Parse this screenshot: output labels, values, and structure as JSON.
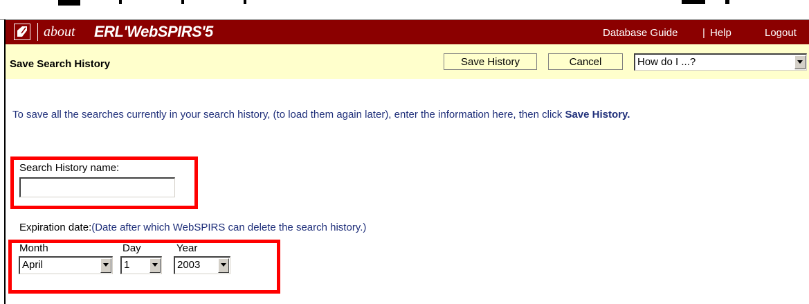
{
  "banner": {
    "brand_about": "about",
    "brand_product": "ERL'WebSPIRS'5",
    "database_guide_link": "Database Guide",
    "separator": "|",
    "help_link": "Help",
    "logout_link": "Logout",
    "background_color": "#8b0000"
  },
  "toolbar": {
    "page_title": "Save Search History",
    "save_history_label": "Save History",
    "cancel_label": "Cancel",
    "how_do_i_value": "How do I ...?",
    "background_color": "#ffffcc"
  },
  "main": {
    "intro_text": "To save all the searches currently in your search history, (to load them again later), enter the information here, then click ",
    "intro_bold": "Save History.",
    "history_name_label": "Search History name:",
    "history_name_value": "",
    "expiration_label": "Expiration date:",
    "expiration_note": "(Date after which WebSPIRS can delete the search history.)",
    "month_label": "Month",
    "day_label": "Day",
    "year_label": "Year",
    "month_value": "April",
    "day_value": "1",
    "year_value": "2003",
    "highlight_color": "#ff0000",
    "text_color": "#1f2f7a"
  }
}
